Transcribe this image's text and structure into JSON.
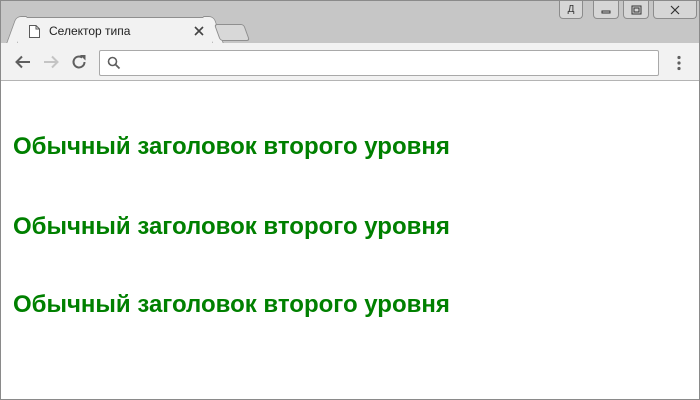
{
  "tab": {
    "title": "Селектор типа",
    "icon": "document-icon"
  },
  "window_controls": {
    "user_label": "Д",
    "icons": [
      "minimize-icon",
      "maximize-icon",
      "close-icon"
    ]
  },
  "toolbar": {
    "icons": [
      "back-icon",
      "forward-icon",
      "reload-icon",
      "search-icon",
      "menu-icon"
    ],
    "address_value": "",
    "address_placeholder": ""
  },
  "content": {
    "heading_color": "#008000",
    "headings": [
      "Обычный заголовок второго уровня",
      "Обычный заголовок второго уровня",
      "Обычный заголовок второго уровня"
    ]
  }
}
